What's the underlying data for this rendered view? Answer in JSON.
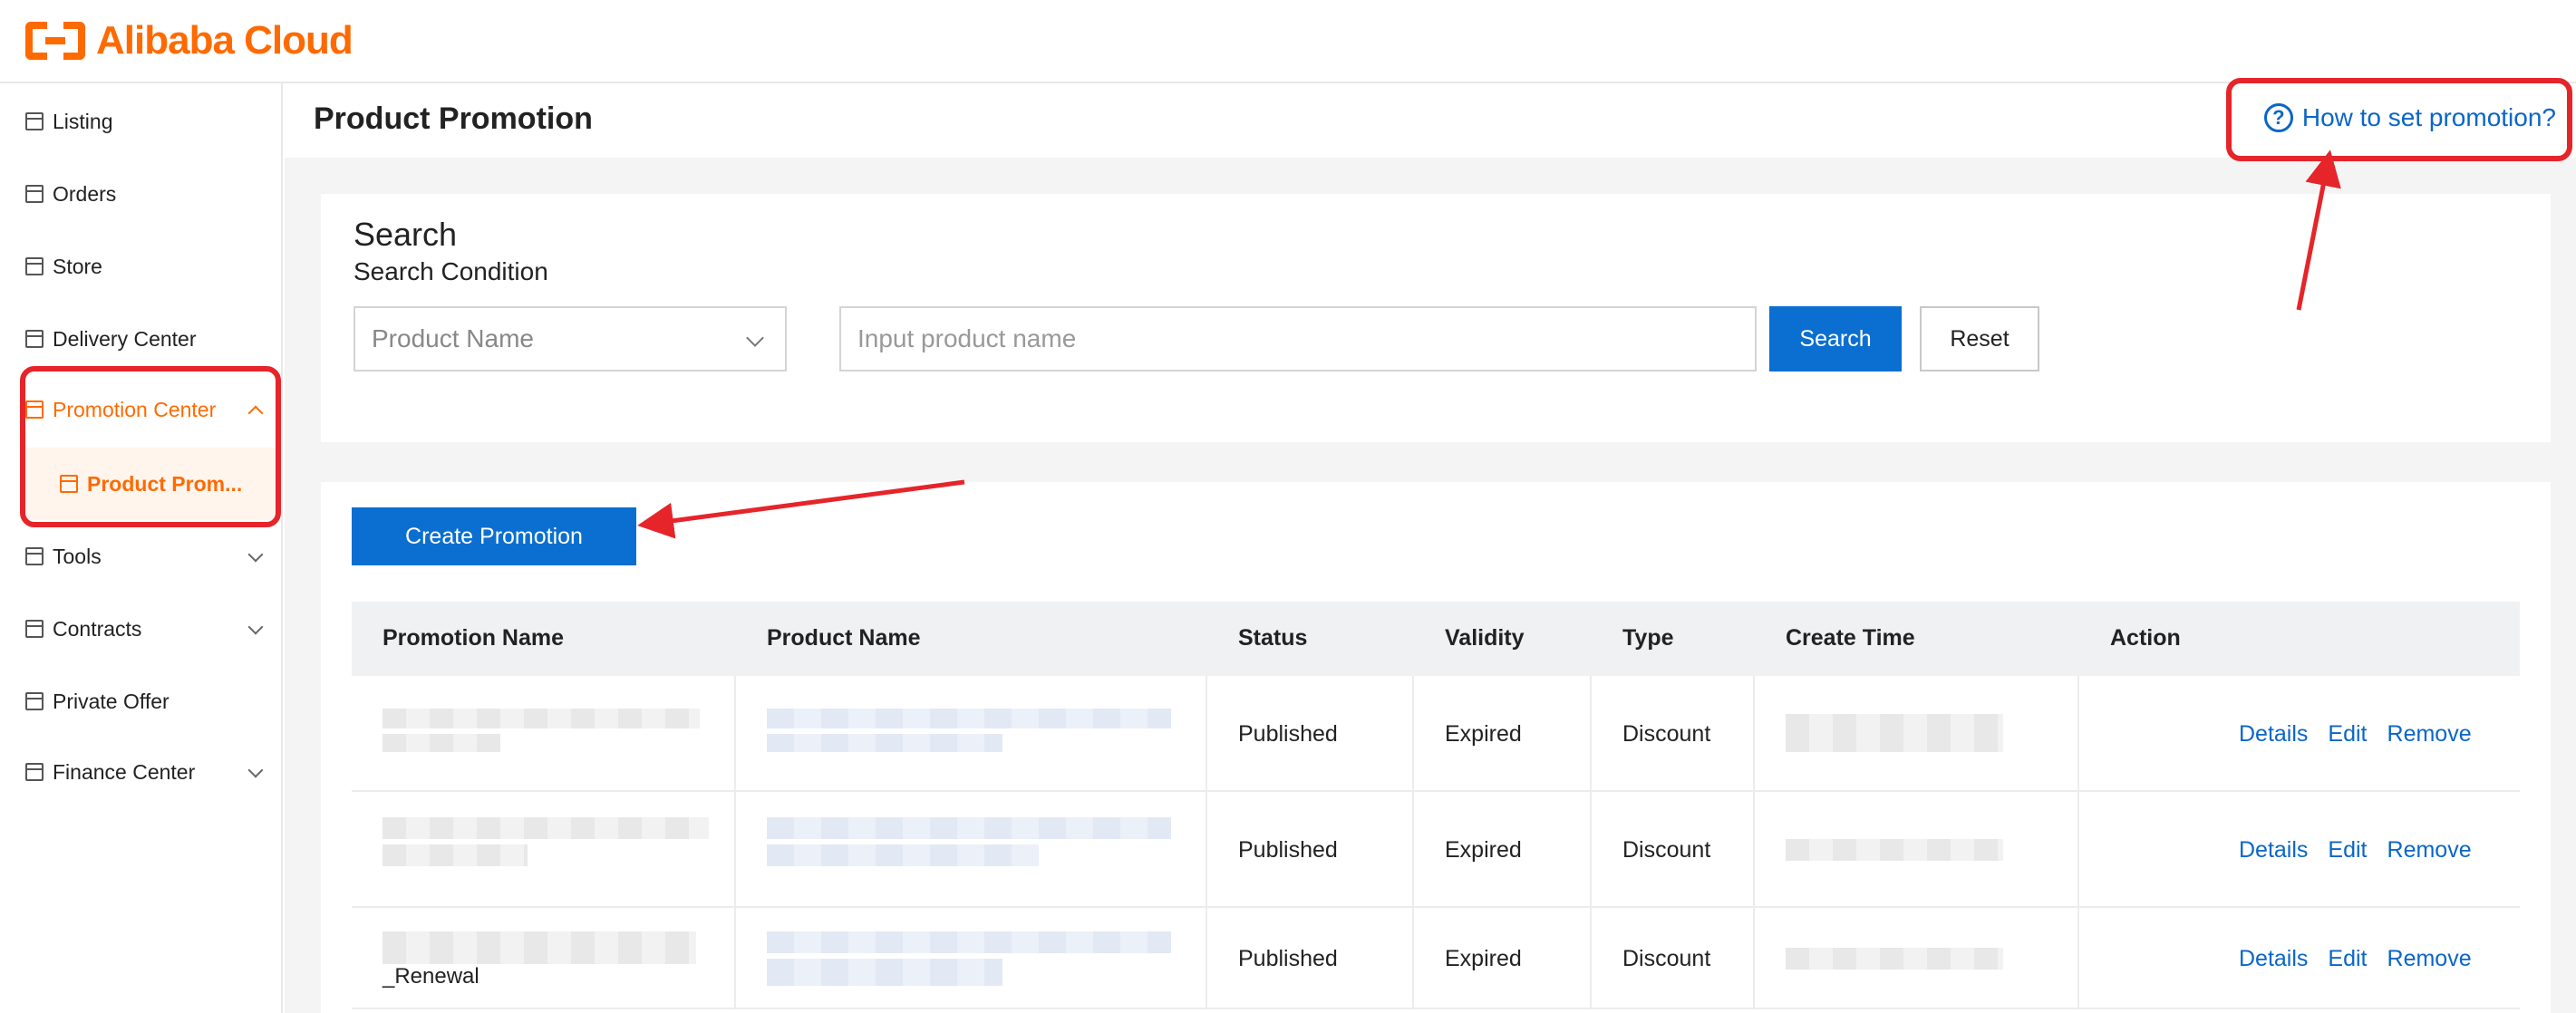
{
  "brand": {
    "name": "Alibaba Cloud"
  },
  "sidebar": {
    "items": [
      {
        "label": "Listing",
        "expandable": false
      },
      {
        "label": "Orders",
        "expandable": false
      },
      {
        "label": "Store",
        "expandable": false
      },
      {
        "label": "Delivery Center",
        "expandable": false
      },
      {
        "label": "Promotion Center",
        "expandable": true,
        "expanded": true,
        "active": true
      },
      {
        "label": "Tools",
        "expandable": true
      },
      {
        "label": "Contracts",
        "expandable": true
      },
      {
        "label": "Private Offer",
        "expandable": false
      },
      {
        "label": "Finance Center",
        "expandable": true
      }
    ],
    "sub_item": {
      "label": "Product Prom..."
    }
  },
  "page": {
    "title": "Product Promotion",
    "help_link": "How to set promotion?"
  },
  "search": {
    "heading": "Search",
    "subheading": "Search Condition",
    "select_value": "Product Name",
    "input_placeholder": "Input product name",
    "search_button": "Search",
    "reset_button": "Reset"
  },
  "list": {
    "create_button": "Create Promotion",
    "columns": [
      "Promotion Name",
      "Product Name",
      "Status",
      "Validity",
      "Type",
      "Create Time",
      "Action"
    ],
    "rows": [
      {
        "status": "Published",
        "validity": "Expired",
        "type": "Discount",
        "name_suffix": ""
      },
      {
        "status": "Published",
        "validity": "Expired",
        "type": "Discount",
        "name_suffix": ""
      },
      {
        "status": "Published",
        "validity": "Expired",
        "type": "Discount",
        "name_suffix": "_Renewal"
      }
    ],
    "actions": [
      "Details",
      "Edit",
      "Remove"
    ]
  },
  "colors": {
    "brand_orange": "#ff6a00",
    "primary_blue": "#0a6fd0",
    "link_blue": "#0a66c8",
    "annotation_red": "#e5252a"
  },
  "icons": {
    "nav": "calendar-icon",
    "help": "question-circle-icon",
    "dropdown": "chevron-down-icon"
  }
}
